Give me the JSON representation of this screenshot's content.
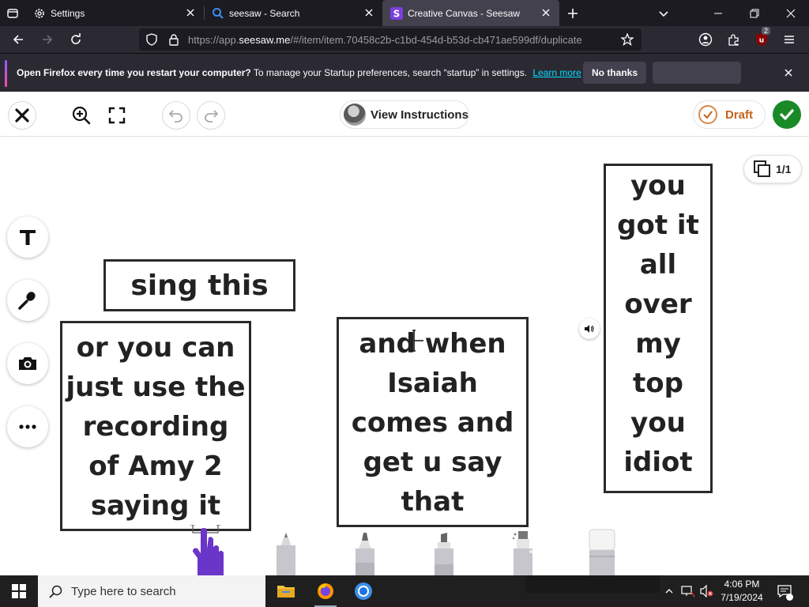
{
  "browser": {
    "tabs": [
      {
        "title": "Settings",
        "icon": "gear-icon",
        "active": false
      },
      {
        "title": "seesaw - Search",
        "icon": "search-icon",
        "active": false
      },
      {
        "title": "Creative Canvas - Seesaw",
        "icon": "seesaw-logo-icon",
        "active": true
      }
    ],
    "url_prefix": "https://app.",
    "url_domain": "seesaw.me",
    "url_rest": "/#/item/item.70458c2b-c1bd-454d-b53d-cb471ae599df/duplicate",
    "extension_badge": "2"
  },
  "notification": {
    "title": "Open Firefox every time you restart your computer?",
    "body": "To manage your Startup preferences, search “startup” in settings.",
    "learn_more": "Learn more",
    "no_thanks": "No thanks"
  },
  "toolbar": {
    "view_instructions": "View Instructions",
    "draft": "Draft"
  },
  "page_indicator": "1/1",
  "canvas": {
    "box1": [
      "sing this"
    ],
    "box2": [
      "or you can",
      "just use the",
      "recording",
      "of Amy 2",
      "saying it"
    ],
    "box3": [
      "and when",
      "Isaiah",
      "comes and",
      "get u say",
      "that"
    ],
    "box4": [
      "you",
      "got it",
      "all",
      "over",
      "my",
      "top",
      "you",
      "idiot"
    ]
  },
  "taskbar": {
    "search_placeholder": "Type here to search",
    "time": "4:06 PM",
    "date": "7/19/2024"
  },
  "colors": {
    "seesaw_purple": "#6c33d9",
    "done_green": "#1a8a27",
    "draft_orange": "#c4621c"
  }
}
